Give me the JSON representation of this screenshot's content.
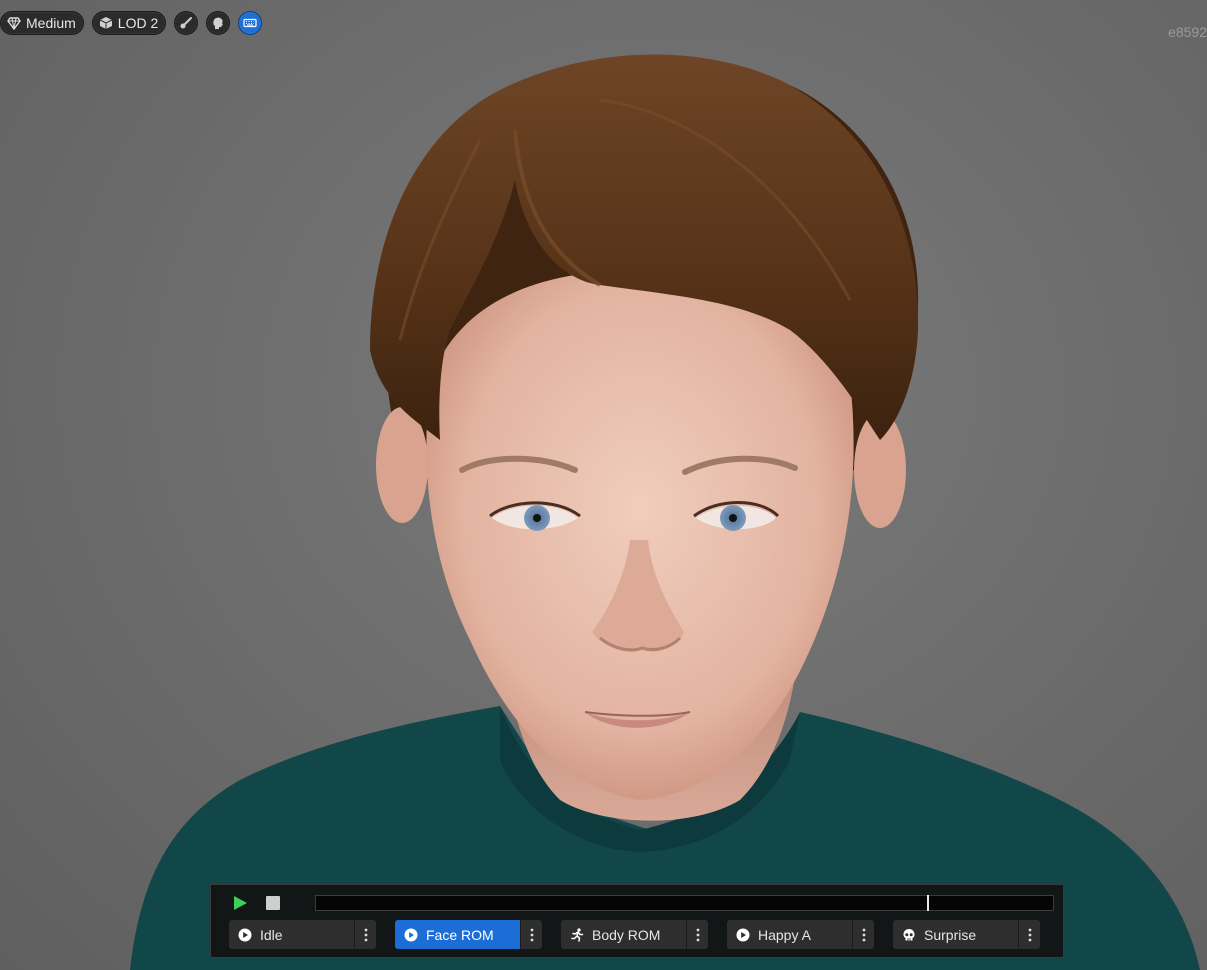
{
  "toolbar": {
    "quality_label": "Medium",
    "lod_label": "LOD 2",
    "hash_text": "e8592"
  },
  "playback": {
    "progress": 0.831,
    "animations": [
      {
        "label": "Idle",
        "icon": "play-circle-icon",
        "selected": false
      },
      {
        "label": "Face ROM",
        "icon": "play-circle-icon",
        "selected": true
      },
      {
        "label": "Body ROM",
        "icon": "running-figure-icon",
        "selected": false
      },
      {
        "label": "Happy A",
        "icon": "play-circle-icon",
        "selected": false
      },
      {
        "label": "Surprise",
        "icon": "skull-icon",
        "selected": false
      }
    ]
  },
  "colors": {
    "accent": "#1c6ed6",
    "play_green": "#3ecf5a",
    "panel_bg": "#121212",
    "viewport_bg": "#6e6e6e",
    "sweater": "#12474a",
    "hair": "#5a3519",
    "skin": "#e9c3b1",
    "eyes": "#6f8fb3"
  }
}
